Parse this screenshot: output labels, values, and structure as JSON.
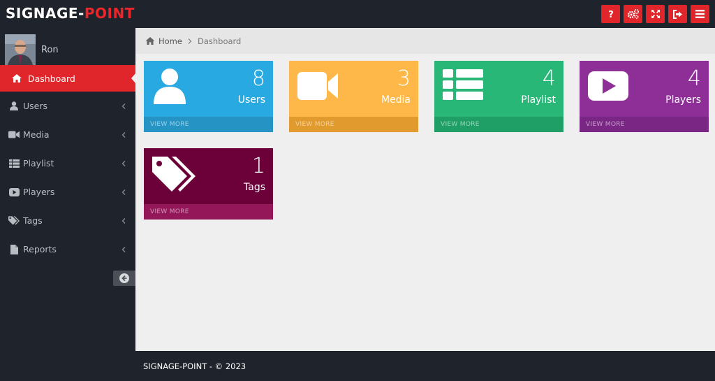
{
  "brand": {
    "part1": "SIGNAGE-",
    "part2": "POINT"
  },
  "toolbar": {
    "buttons": [
      {
        "name": "help",
        "icon": "question-icon"
      },
      {
        "name": "settings",
        "icon": "gears-icon"
      },
      {
        "name": "fullscreen",
        "icon": "expand-icon"
      },
      {
        "name": "logout",
        "icon": "sign-out-icon"
      },
      {
        "name": "menu",
        "icon": "bars-icon"
      }
    ]
  },
  "user": {
    "name": "Ron"
  },
  "sidebar": {
    "items": [
      {
        "label": "Dashboard",
        "icon": "home-icon",
        "active": true
      },
      {
        "label": "Users",
        "icon": "user-icon"
      },
      {
        "label": "Media",
        "icon": "video-camera-icon"
      },
      {
        "label": "Playlist",
        "icon": "list-icon"
      },
      {
        "label": "Players",
        "icon": "play-icon"
      },
      {
        "label": "Tags",
        "icon": "tags-icon"
      },
      {
        "label": "Reports",
        "icon": "file-icon"
      }
    ]
  },
  "breadcrumb": {
    "home": "Home",
    "current": "Dashboard"
  },
  "tiles": [
    {
      "count": "8",
      "label": "Users",
      "more": "VIEW MORE",
      "color": "#28a9e1",
      "footer_color": "#2594c4",
      "icon": "user-icon"
    },
    {
      "count": "3",
      "label": "Media",
      "more": "VIEW MORE",
      "color": "#fdb849",
      "footer_color": "#e09a2e",
      "icon": "video-camera-icon"
    },
    {
      "count": "4",
      "label": "Playlist",
      "more": "VIEW MORE",
      "color": "#29b778",
      "footer_color": "#1f9f66",
      "icon": "list-icon"
    },
    {
      "count": "4",
      "label": "Players",
      "more": "VIEW MORE",
      "color": "#8e2f98",
      "footer_color": "#7a2684",
      "icon": "youtube-play-icon"
    },
    {
      "count": "1",
      "label": "Tags",
      "more": "VIEW MORE",
      "color": "#6c0038",
      "footer_color": "#94175a",
      "icon": "tags-icon"
    }
  ],
  "footer": {
    "text": "SIGNAGE-POINT - © 2023"
  }
}
